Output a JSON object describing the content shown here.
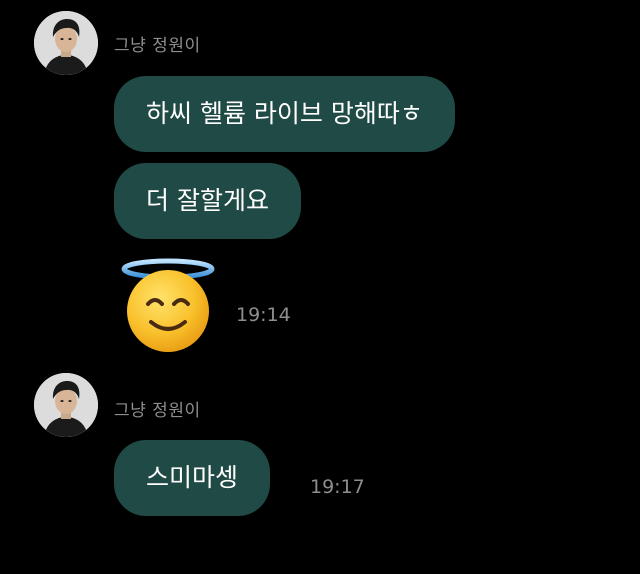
{
  "groups": [
    {
      "sender": "그냥 정원이",
      "avatar_icon": "profile-photo",
      "messages": [
        {
          "text": "하씨 헬륨 라이브 망해따ㅎ"
        },
        {
          "text": "더 잘할게요"
        }
      ],
      "sticker": {
        "icon": "smiling-face-with-halo-emoji",
        "time": "19:14"
      }
    },
    {
      "sender": "그냥 정원이",
      "avatar_icon": "profile-photo",
      "messages": [
        {
          "text": "스미마셍",
          "time": "19:17"
        }
      ]
    }
  ],
  "colors": {
    "background": "#000000",
    "bubble": "#204a45",
    "bubble_text": "#ffffff",
    "meta_text": "#8e8e8e"
  }
}
